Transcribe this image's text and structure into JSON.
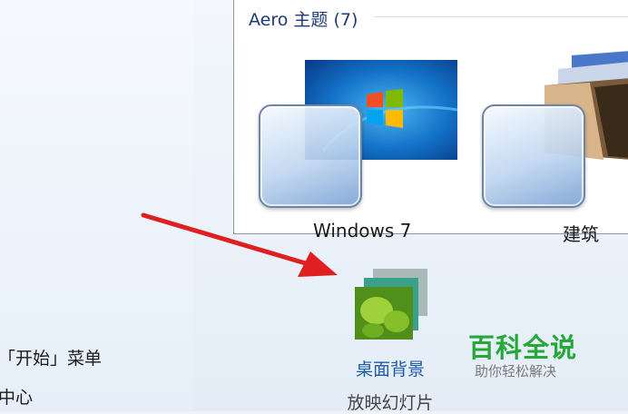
{
  "sidebar": {
    "links": [
      {
        "label": "「开始」菜单"
      },
      {
        "label": "中心"
      }
    ]
  },
  "themes": {
    "group_header": "Aero 主题 (7)",
    "items": [
      {
        "label": "Windows 7"
      },
      {
        "label": "建筑"
      }
    ]
  },
  "bottom": {
    "desktop_background": {
      "label": "桌面背景",
      "sublabel": "放映幻灯片"
    }
  },
  "watermark": {
    "title": "百科全说",
    "subtitle": "助你轻松解决"
  },
  "colors": {
    "accent_link": "#1e5aa8",
    "arrow": "#e02020",
    "watermark": "#25a838"
  }
}
